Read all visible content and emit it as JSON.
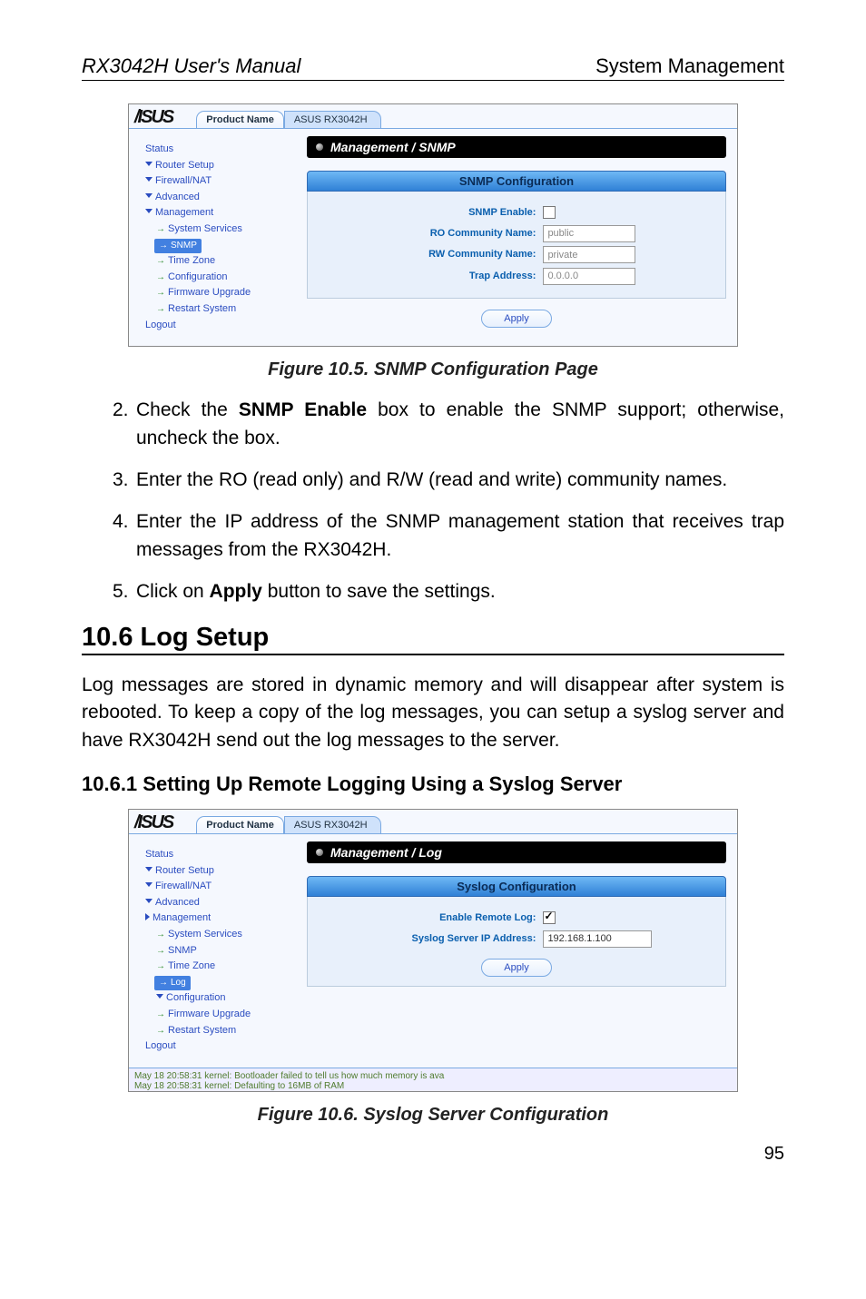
{
  "header": {
    "left": "RX3042H User's Manual",
    "right": "System Management"
  },
  "panel1": {
    "product_tab_label": "Product Name",
    "product_tab_value": "ASUS RX3042H",
    "nav": {
      "status": "Status",
      "router_setup": "Router Setup",
      "firewall_nat": "Firewall/NAT",
      "advanced": "Advanced",
      "management": "Management",
      "sys_services": "System Services",
      "snmp": "SNMP",
      "timezone": "Time Zone",
      "configuration": "Configuration",
      "fw_upgrade": "Firmware Upgrade",
      "restart": "Restart System",
      "logout": "Logout"
    },
    "title": "Management / SNMP",
    "config_header": "SNMP Configuration",
    "rows": {
      "enable_lbl": "SNMP Enable:",
      "ro_lbl": "RO Community Name:",
      "ro_val": "public",
      "rw_lbl": "RW Community Name:",
      "rw_val": "private",
      "trap_lbl": "Trap Address:",
      "trap_val": "0.0.0.0"
    },
    "apply": "Apply"
  },
  "caption1": "Figure 10.5. SNMP Configuration Page",
  "list": [
    {
      "num": "2.",
      "pre": "Check the ",
      "bold": "SNMP Enable",
      "post": " box to enable the SNMP support; otherwise, uncheck the box."
    },
    {
      "num": "3.",
      "text": "Enter the RO (read only) and R/W (read and write) community names."
    },
    {
      "num": "4.",
      "text": "Enter the IP address of the SNMP management station that receives trap messages from the RX3042H."
    },
    {
      "num": "5.",
      "pre": "Click on ",
      "bold": "Apply",
      "post": " button to save the settings."
    }
  ],
  "section_heading": "10.6    Log Setup",
  "body_para": "Log messages are stored in dynamic memory and will disappear after system is rebooted. To keep a copy of the log messages, you can setup a syslog server and have RX3042H send out the log messages to the server.",
  "subsection_heading": "10.6.1 Setting Up Remote Logging Using a Syslog Server",
  "panel2": {
    "product_tab_label": "Product Name",
    "product_tab_value": "ASUS RX3042H",
    "nav": {
      "status": "Status",
      "router_setup": "Router Setup",
      "firewall_nat": "Firewall/NAT",
      "advanced": "Advanced",
      "management": "Management",
      "sys_services": "System Services",
      "snmp": "SNMP",
      "timezone": "Time Zone",
      "log": "Log",
      "configuration": "Configuration",
      "fw_upgrade": "Firmware Upgrade",
      "restart": "Restart System",
      "logout": "Logout"
    },
    "title": "Management / Log",
    "config_header": "Syslog Configuration",
    "rows": {
      "enable_lbl": "Enable Remote Log:",
      "ip_lbl": "Syslog Server IP Address:",
      "ip_val": "192.168.1.100"
    },
    "apply": "Apply",
    "footer_line1": "May 18 20:58:31 kernel: Bootloader failed to tell us how much memory is ava",
    "footer_line2": "May 18 20:58:31 kernel: Defaulting to 16MB of RAM"
  },
  "caption2": "Figure 10.6. Syslog Server Configuration",
  "page_number": "95"
}
